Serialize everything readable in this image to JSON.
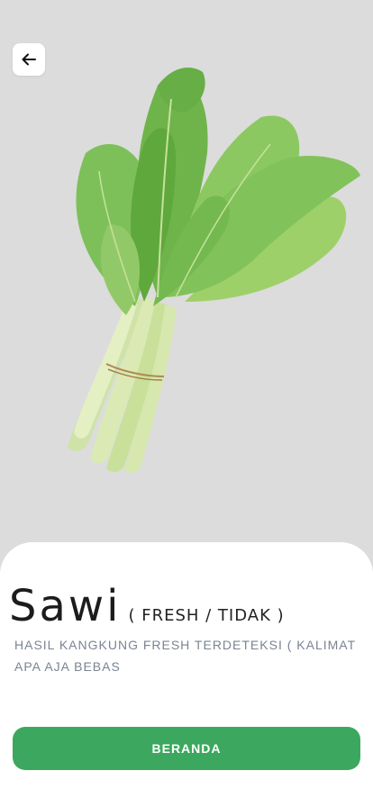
{
  "product": {
    "name": "Sawi",
    "status_hint": "( FRESH / TIDAK )",
    "description": "HASIL KANGKUNG FRESH TERDETEKSI ( KALIMAT APA AJA BEBAS",
    "image_subject": "sawi-bunch"
  },
  "nav": {
    "back_icon": "arrow-left-icon"
  },
  "actions": {
    "home_label": "BERANDA"
  },
  "colors": {
    "hero_background": "#dcdcdc",
    "primary_button": "#3ca85f",
    "description_text": "#7b8492",
    "title_text": "#1c1c1c"
  }
}
